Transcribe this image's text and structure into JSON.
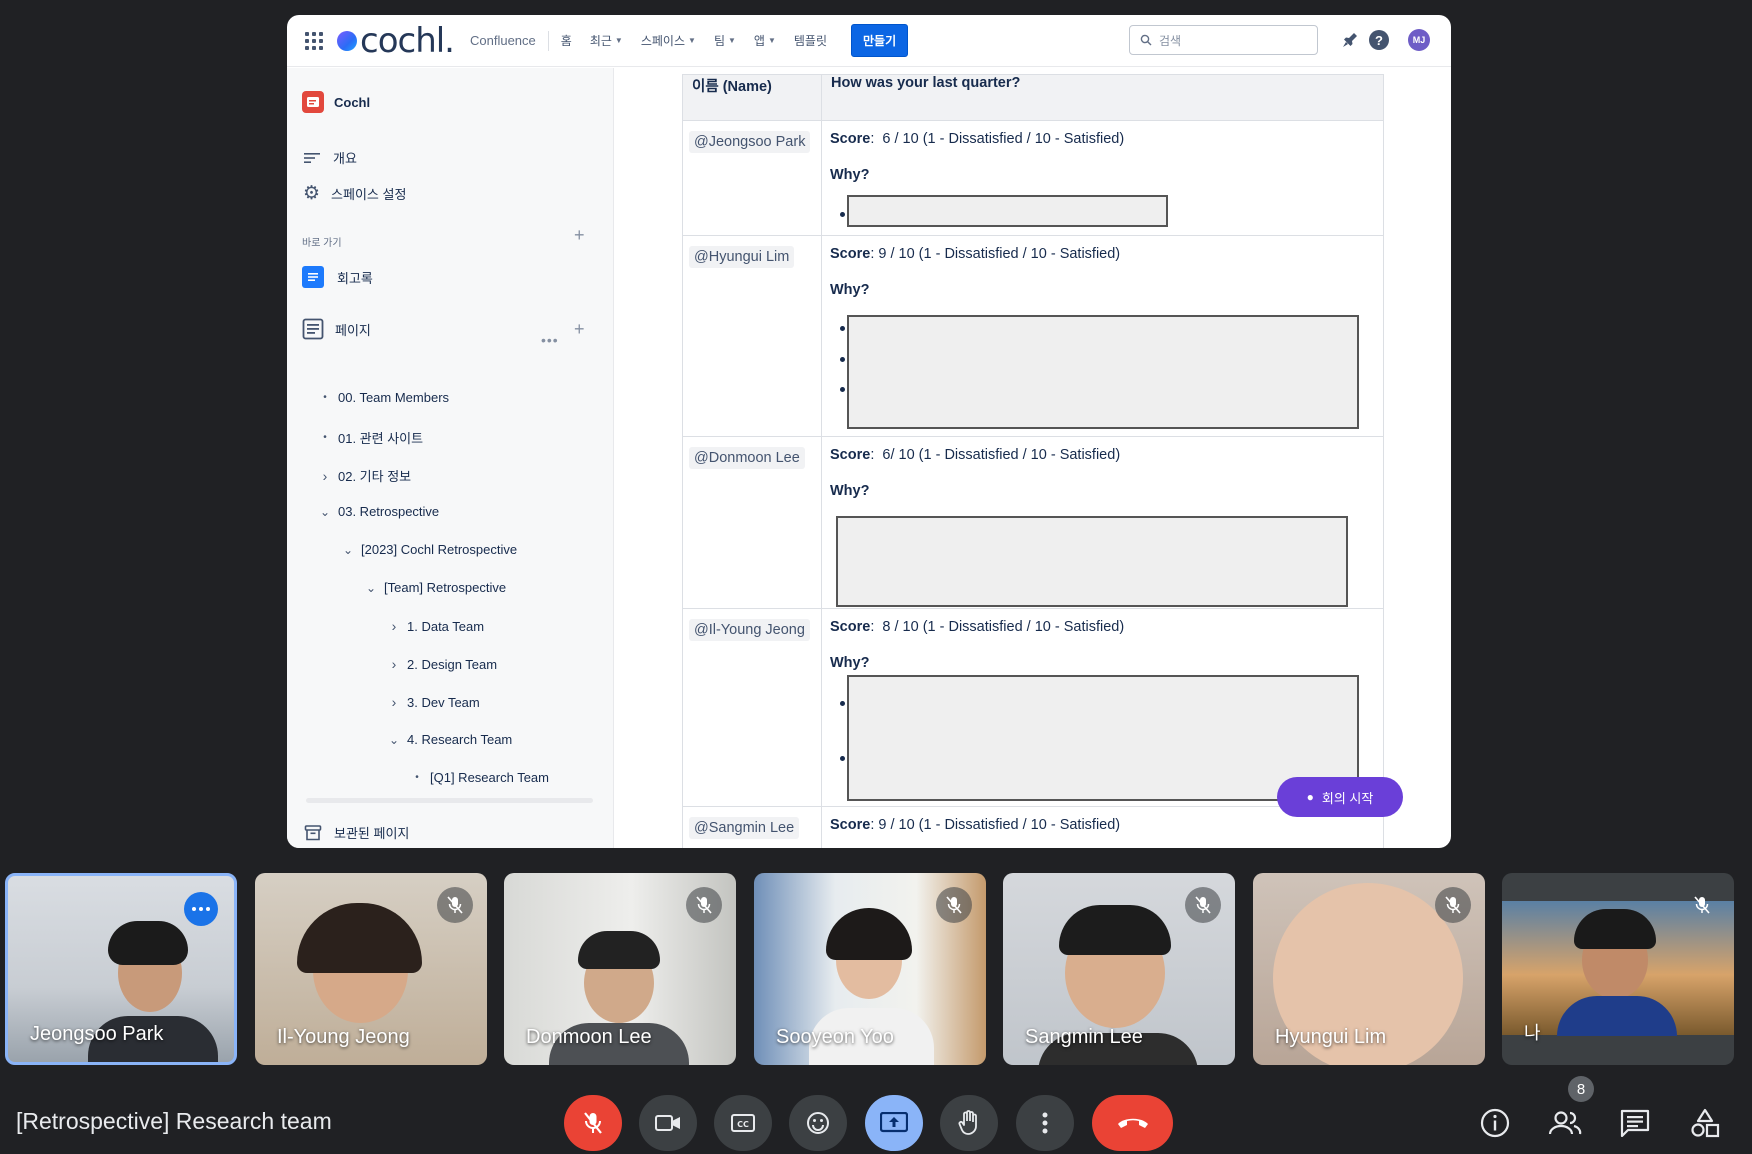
{
  "confluence": {
    "logo_text": "cochl.",
    "product": "Confluence",
    "nav": [
      {
        "label": "홈",
        "chevron": false
      },
      {
        "label": "최근",
        "chevron": true
      },
      {
        "label": "스페이스",
        "chevron": true
      },
      {
        "label": "팀",
        "chevron": true
      },
      {
        "label": "앱",
        "chevron": true
      },
      {
        "label": "템플릿",
        "chevron": false
      }
    ],
    "create_label": "만들기",
    "search_placeholder": "검색",
    "avatar_initials": "MJ"
  },
  "sidebar": {
    "space_name": "Cochl",
    "overview": "개요",
    "space_settings": "스페이스 설정",
    "shortcuts_header": "바로 가기",
    "shortcut_item": "회고록",
    "pages_header": "페이지",
    "tree": [
      {
        "label": "00. Team Members",
        "marker": "•"
      },
      {
        "label": "01. 관련 사이트",
        "marker": "•"
      },
      {
        "label": "02. 기타 정보",
        "marker": "›"
      },
      {
        "label": "03. Retrospective",
        "marker": "⌄"
      },
      {
        "label": "[2023] Cochl Retrospective",
        "marker": "⌄"
      },
      {
        "label": "[Team] Retrospective",
        "marker": "⌄"
      },
      {
        "label": "1. Data Team",
        "marker": "›"
      },
      {
        "label": "2. Design Team",
        "marker": "›"
      },
      {
        "label": "3. Dev Team",
        "marker": "›"
      },
      {
        "label": "4. Research Team",
        "marker": "⌄"
      },
      {
        "label": "[Q1] Research Team",
        "marker": "•"
      }
    ],
    "archived": "보관된 페이지"
  },
  "table": {
    "headers": [
      "이름 (Name)",
      "How was your last quarter?"
    ],
    "score_label": "Score",
    "why_label": "Why?",
    "rows": [
      {
        "name": "@Jeongsoo Park",
        "score": "6 / 10 (1 - Dissatisfied / 10 - Satisfied)"
      },
      {
        "name": "@Hyungui Lim",
        "score": "9 / 10 (1 - Dissatisfied / 10 - Satisfied)"
      },
      {
        "name": "@Donmoon Lee",
        "score": "6/ 10 (1 - Dissatisfied / 10 - Satisfied)"
      },
      {
        "name": "@Il-Young Jeong",
        "score": "8 / 10 (1 - Dissatisfied / 10 - Satisfied)"
      },
      {
        "name": "@Sangmin Lee",
        "score": "9 / 10 (1 - Dissatisfied / 10 - Satisfied)"
      }
    ],
    "float_button_label": "회의 시작"
  },
  "participants": [
    {
      "name": "Jeongsoo Park",
      "active": true
    },
    {
      "name": "Il-Young Jeong",
      "muted": true
    },
    {
      "name": "Donmoon Lee",
      "muted": true
    },
    {
      "name": "Sooyeon Yoo",
      "muted": true
    },
    {
      "name": "Sangmin Lee",
      "muted": true
    },
    {
      "name": "Hyungui Lim",
      "muted": true
    },
    {
      "name": "나",
      "muted": true
    }
  ],
  "meeting": {
    "title": "[Retrospective] Research team",
    "participant_count": "8"
  },
  "colors": {
    "accent_blue": "#0c66e4",
    "meet_red": "#ea4335",
    "meet_blue": "#8ab4f8"
  }
}
